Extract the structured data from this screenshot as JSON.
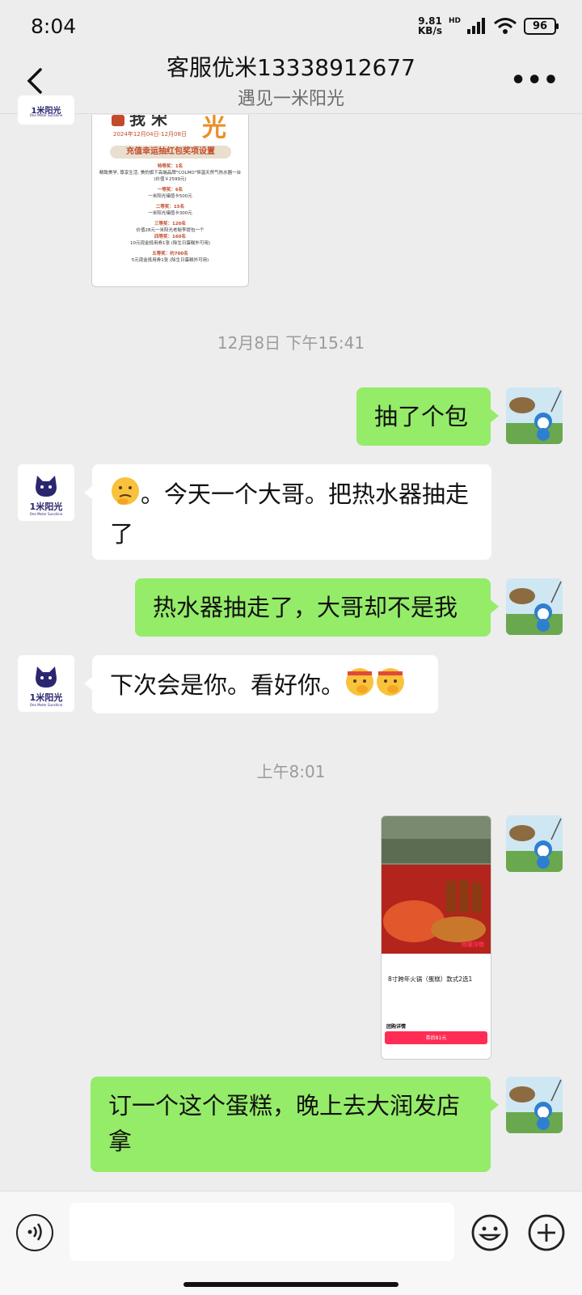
{
  "status": {
    "time": "8:04",
    "net_speed": "9.81",
    "net_unit": "KB/s",
    "hd": "HD",
    "battery": "96"
  },
  "header": {
    "title": "客服优米13338912677",
    "subtitle": "遇见一米阳光"
  },
  "poster": {
    "date": "2024年12月04日-12月08日",
    "banner": "充值幸运抽红包奖项设置",
    "lines": [
      {
        "tier": "特等奖：1名",
        "text": "精致美学, 尊享生活, 美的旗下高端品牌\"COLMO\"恒温天然气热水器一台 (价值￥2599元)"
      },
      {
        "tier": "一等奖：6名",
        "text": "一米阳光储值卡500元"
      },
      {
        "tier": "二等奖：15名",
        "text": "一米阳光储值卡300元"
      },
      {
        "tier": "三等奖：120名",
        "text": "价值28元一米阳光老秘李提包一个"
      },
      {
        "tier": "四等奖：160名",
        "text": "10元现金抵用券1张 (除生日蛋糕外可用)"
      },
      {
        "tier": "五等奖：约700名",
        "text": "5元现金抵用券1张 (除生日蛋糕外可用)"
      }
    ]
  },
  "messages": {
    "time1": "12月8日 下午15:41",
    "m1": "抽了个包",
    "m2": "。今天一个大哥。把热水器抽走了",
    "m3": "热水器抽走了，大哥却不是我",
    "m4": "下次会是你。看好你。",
    "time2": "上午8:01",
    "m5": "订一个这个蛋糕，晚上去大润发店拿"
  },
  "shot": {
    "product": "8寸跨年火锅（蛋糕）款式2选1",
    "price": "券后81元",
    "promo": "特惠详情",
    "section": "团购详情"
  },
  "avatar_left": {
    "brand": "1米阳光",
    "sub": "One Meter Sunshine"
  },
  "input": {
    "placeholder": ""
  }
}
